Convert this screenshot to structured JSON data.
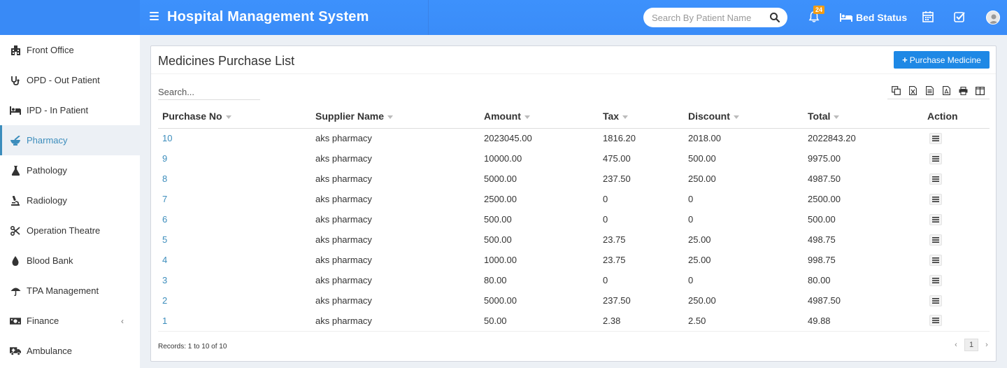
{
  "header": {
    "title": "Hospital Management System",
    "search_placeholder": "Search By Patient Name",
    "notification_count": "24",
    "bed_status_label": "Bed Status"
  },
  "sidebar": {
    "items": [
      {
        "label": "Front Office",
        "icon": "building-icon"
      },
      {
        "label": "OPD - Out Patient",
        "icon": "stethoscope-icon"
      },
      {
        "label": "IPD - In Patient",
        "icon": "bed-icon"
      },
      {
        "label": "Pharmacy",
        "icon": "mortar-pestle-icon",
        "active": true
      },
      {
        "label": "Pathology",
        "icon": "flask-icon"
      },
      {
        "label": "Radiology",
        "icon": "microscope-icon"
      },
      {
        "label": "Operation Theatre",
        "icon": "scissors-icon"
      },
      {
        "label": "Blood Bank",
        "icon": "blood-drop-icon"
      },
      {
        "label": "TPA Management",
        "icon": "umbrella-icon"
      },
      {
        "label": "Finance",
        "icon": "money-icon",
        "chevron": "‹"
      },
      {
        "label": "Ambulance",
        "icon": "ambulance-icon"
      }
    ]
  },
  "main": {
    "title": "Medicines Purchase List",
    "purchase_button": "Purchase Medicine",
    "table_search_placeholder": "Search...",
    "columns": [
      "Purchase No",
      "Supplier Name",
      "Amount",
      "Tax",
      "Discount",
      "Total",
      "Action"
    ],
    "rows": [
      [
        "10",
        "aks pharmacy",
        "2023045.00",
        "1816.20",
        "2018.00",
        "2022843.20"
      ],
      [
        "9",
        "aks pharmacy",
        "10000.00",
        "475.00",
        "500.00",
        "9975.00"
      ],
      [
        "8",
        "aks pharmacy",
        "5000.00",
        "237.50",
        "250.00",
        "4987.50"
      ],
      [
        "7",
        "aks pharmacy",
        "2500.00",
        "0",
        "0",
        "2500.00"
      ],
      [
        "6",
        "aks pharmacy",
        "500.00",
        "0",
        "0",
        "500.00"
      ],
      [
        "5",
        "aks pharmacy",
        "500.00",
        "23.75",
        "25.00",
        "498.75"
      ],
      [
        "4",
        "aks pharmacy",
        "1000.00",
        "23.75",
        "25.00",
        "998.75"
      ],
      [
        "3",
        "aks pharmacy",
        "80.00",
        "0",
        "0",
        "80.00"
      ],
      [
        "2",
        "aks pharmacy",
        "5000.00",
        "237.50",
        "250.00",
        "4987.50"
      ],
      [
        "1",
        "aks pharmacy",
        "50.00",
        "2.38",
        "2.50",
        "49.88"
      ]
    ],
    "records_text": "Records: 1 to 10 of 10",
    "pagination": {
      "prev": "‹",
      "current": "1",
      "next": "›"
    }
  },
  "colors": {
    "header": "#3c8dfa",
    "accent": "#3c8dbc",
    "button": "#1e88e5",
    "badge": "#f39c12"
  }
}
